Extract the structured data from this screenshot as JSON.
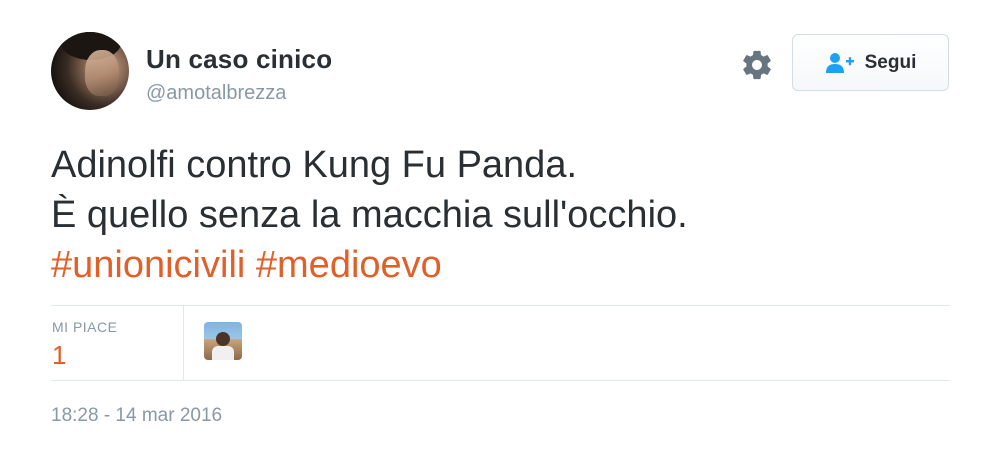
{
  "user": {
    "display_name": "Un caso cinico",
    "handle": "@amotalbrezza"
  },
  "actions": {
    "follow_label": "Segui"
  },
  "tweet": {
    "line1": "Adinolfi contro Kung Fu Panda.",
    "line2": "È quello senza la macchia sull'occhio.",
    "hashtags": [
      "#unionicivili",
      "#medioevo"
    ]
  },
  "stats": {
    "likes_label": "MI PIACE",
    "likes_count": "1"
  },
  "timestamp": "18:28 - 14 mar 2016",
  "icons": {
    "settings": "gear-icon",
    "follow": "add-user-icon"
  },
  "colors": {
    "accent": "#e0602a",
    "muted": "#8899a6",
    "text": "#292f33",
    "icon": "#66757f",
    "follow_icon": "#1da1f2"
  }
}
